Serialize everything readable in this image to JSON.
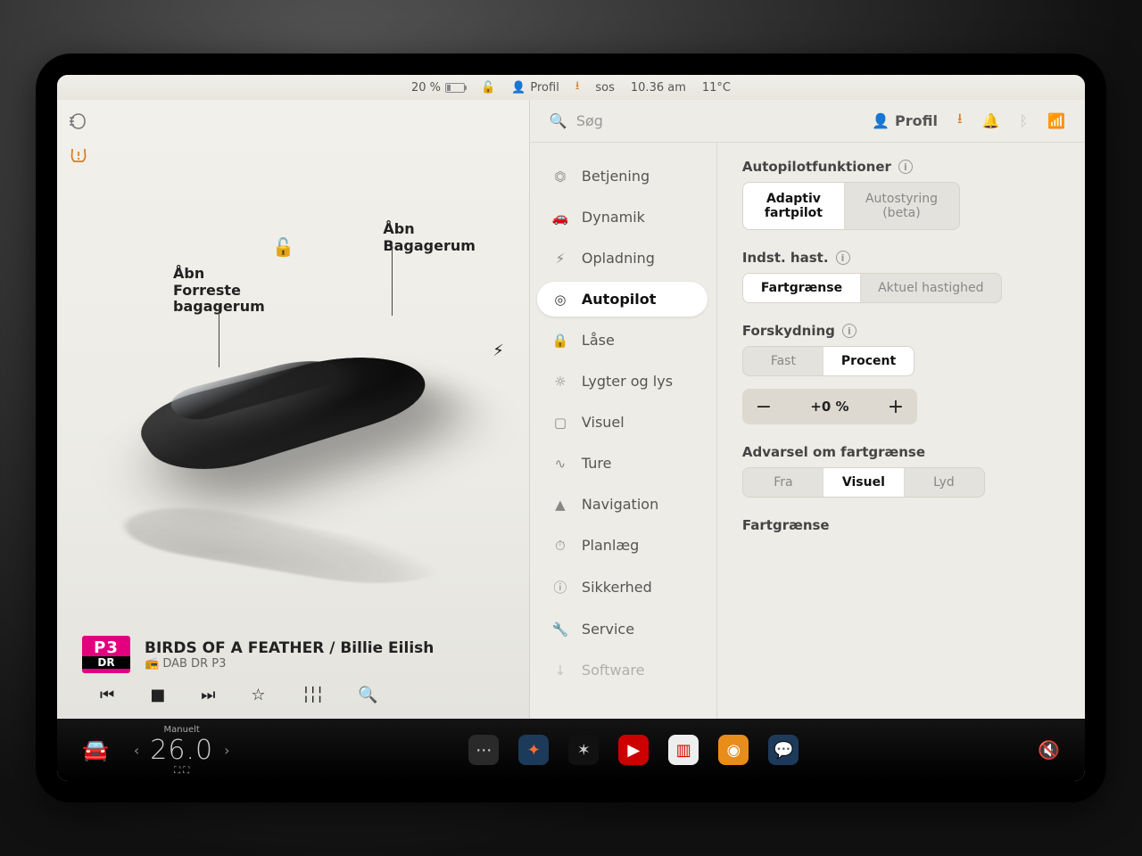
{
  "status": {
    "battery_pct": "20 %",
    "profile": "Profil",
    "sos": "sos",
    "time": "10.36 am",
    "temp": "11°C"
  },
  "car": {
    "frunk_label": "Åbn\nForreste\nbagagerum",
    "trunk_label": "Åbn\nBagagerum"
  },
  "media": {
    "badge_top": "P3",
    "badge_bottom": "DR",
    "title": "BIRDS OF A FEATHER / Billie Eilish",
    "source": "DAB DR P3"
  },
  "search": {
    "placeholder": "Søg",
    "profile": "Profil"
  },
  "menu": {
    "items": [
      {
        "icon": "⏣",
        "label": "Betjening"
      },
      {
        "icon": "🚗",
        "label": "Dynamik"
      },
      {
        "icon": "⚡",
        "label": "Opladning"
      },
      {
        "icon": "◎",
        "label": "Autopilot"
      },
      {
        "icon": "🔒",
        "label": "Låse"
      },
      {
        "icon": "☼",
        "label": "Lygter og lys"
      },
      {
        "icon": "▢",
        "label": "Visuel"
      },
      {
        "icon": "∿",
        "label": "Ture"
      },
      {
        "icon": "▲",
        "label": "Navigation"
      },
      {
        "icon": "⏱",
        "label": "Planlæg"
      },
      {
        "icon": "ⓘ",
        "label": "Sikkerhed"
      },
      {
        "icon": "🔧",
        "label": "Service"
      },
      {
        "icon": "↓",
        "label": "Software"
      }
    ]
  },
  "autopilot": {
    "section1_title": "Autopilotfunktioner",
    "opt_adaptive": "Adaptiv\nfartpilot",
    "opt_autosteer": "Autostyring\n(beta)",
    "section2_title": "Indst. hast.",
    "opt_limit": "Fartgrænse",
    "opt_current": "Aktuel hastighed",
    "section3_title": "Forskydning",
    "opt_fixed": "Fast",
    "opt_percent": "Procent",
    "offset_value": "+0 %",
    "section4_title": "Advarsel om fartgrænse",
    "opt_off": "Fra",
    "opt_visual": "Visuel",
    "opt_sound": "Lyd",
    "section5_title": "Fartgrænse"
  },
  "dock": {
    "climate_mode": "Manuelt",
    "temp": "26.0"
  }
}
